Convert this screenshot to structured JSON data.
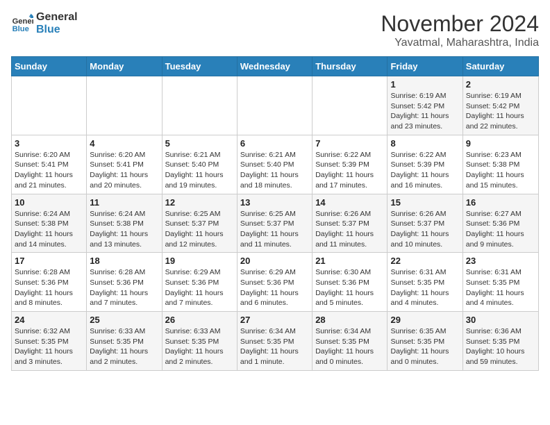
{
  "logo": {
    "line1": "General",
    "line2": "Blue"
  },
  "title": "November 2024",
  "location": "Yavatmal, Maharashtra, India",
  "weekdays": [
    "Sunday",
    "Monday",
    "Tuesday",
    "Wednesday",
    "Thursday",
    "Friday",
    "Saturday"
  ],
  "weeks": [
    [
      {
        "day": "",
        "detail": ""
      },
      {
        "day": "",
        "detail": ""
      },
      {
        "day": "",
        "detail": ""
      },
      {
        "day": "",
        "detail": ""
      },
      {
        "day": "",
        "detail": ""
      },
      {
        "day": "1",
        "detail": "Sunrise: 6:19 AM\nSunset: 5:42 PM\nDaylight: 11 hours\nand 23 minutes."
      },
      {
        "day": "2",
        "detail": "Sunrise: 6:19 AM\nSunset: 5:42 PM\nDaylight: 11 hours\nand 22 minutes."
      }
    ],
    [
      {
        "day": "3",
        "detail": "Sunrise: 6:20 AM\nSunset: 5:41 PM\nDaylight: 11 hours\nand 21 minutes."
      },
      {
        "day": "4",
        "detail": "Sunrise: 6:20 AM\nSunset: 5:41 PM\nDaylight: 11 hours\nand 20 minutes."
      },
      {
        "day": "5",
        "detail": "Sunrise: 6:21 AM\nSunset: 5:40 PM\nDaylight: 11 hours\nand 19 minutes."
      },
      {
        "day": "6",
        "detail": "Sunrise: 6:21 AM\nSunset: 5:40 PM\nDaylight: 11 hours\nand 18 minutes."
      },
      {
        "day": "7",
        "detail": "Sunrise: 6:22 AM\nSunset: 5:39 PM\nDaylight: 11 hours\nand 17 minutes."
      },
      {
        "day": "8",
        "detail": "Sunrise: 6:22 AM\nSunset: 5:39 PM\nDaylight: 11 hours\nand 16 minutes."
      },
      {
        "day": "9",
        "detail": "Sunrise: 6:23 AM\nSunset: 5:38 PM\nDaylight: 11 hours\nand 15 minutes."
      }
    ],
    [
      {
        "day": "10",
        "detail": "Sunrise: 6:24 AM\nSunset: 5:38 PM\nDaylight: 11 hours\nand 14 minutes."
      },
      {
        "day": "11",
        "detail": "Sunrise: 6:24 AM\nSunset: 5:38 PM\nDaylight: 11 hours\nand 13 minutes."
      },
      {
        "day": "12",
        "detail": "Sunrise: 6:25 AM\nSunset: 5:37 PM\nDaylight: 11 hours\nand 12 minutes."
      },
      {
        "day": "13",
        "detail": "Sunrise: 6:25 AM\nSunset: 5:37 PM\nDaylight: 11 hours\nand 11 minutes."
      },
      {
        "day": "14",
        "detail": "Sunrise: 6:26 AM\nSunset: 5:37 PM\nDaylight: 11 hours\nand 11 minutes."
      },
      {
        "day": "15",
        "detail": "Sunrise: 6:26 AM\nSunset: 5:37 PM\nDaylight: 11 hours\nand 10 minutes."
      },
      {
        "day": "16",
        "detail": "Sunrise: 6:27 AM\nSunset: 5:36 PM\nDaylight: 11 hours\nand 9 minutes."
      }
    ],
    [
      {
        "day": "17",
        "detail": "Sunrise: 6:28 AM\nSunset: 5:36 PM\nDaylight: 11 hours\nand 8 minutes."
      },
      {
        "day": "18",
        "detail": "Sunrise: 6:28 AM\nSunset: 5:36 PM\nDaylight: 11 hours\nand 7 minutes."
      },
      {
        "day": "19",
        "detail": "Sunrise: 6:29 AM\nSunset: 5:36 PM\nDaylight: 11 hours\nand 7 minutes."
      },
      {
        "day": "20",
        "detail": "Sunrise: 6:29 AM\nSunset: 5:36 PM\nDaylight: 11 hours\nand 6 minutes."
      },
      {
        "day": "21",
        "detail": "Sunrise: 6:30 AM\nSunset: 5:36 PM\nDaylight: 11 hours\nand 5 minutes."
      },
      {
        "day": "22",
        "detail": "Sunrise: 6:31 AM\nSunset: 5:35 PM\nDaylight: 11 hours\nand 4 minutes."
      },
      {
        "day": "23",
        "detail": "Sunrise: 6:31 AM\nSunset: 5:35 PM\nDaylight: 11 hours\nand 4 minutes."
      }
    ],
    [
      {
        "day": "24",
        "detail": "Sunrise: 6:32 AM\nSunset: 5:35 PM\nDaylight: 11 hours\nand 3 minutes."
      },
      {
        "day": "25",
        "detail": "Sunrise: 6:33 AM\nSunset: 5:35 PM\nDaylight: 11 hours\nand 2 minutes."
      },
      {
        "day": "26",
        "detail": "Sunrise: 6:33 AM\nSunset: 5:35 PM\nDaylight: 11 hours\nand 2 minutes."
      },
      {
        "day": "27",
        "detail": "Sunrise: 6:34 AM\nSunset: 5:35 PM\nDaylight: 11 hours\nand 1 minute."
      },
      {
        "day": "28",
        "detail": "Sunrise: 6:34 AM\nSunset: 5:35 PM\nDaylight: 11 hours\nand 0 minutes."
      },
      {
        "day": "29",
        "detail": "Sunrise: 6:35 AM\nSunset: 5:35 PM\nDaylight: 11 hours\nand 0 minutes."
      },
      {
        "day": "30",
        "detail": "Sunrise: 6:36 AM\nSunset: 5:35 PM\nDaylight: 10 hours\nand 59 minutes."
      }
    ]
  ]
}
